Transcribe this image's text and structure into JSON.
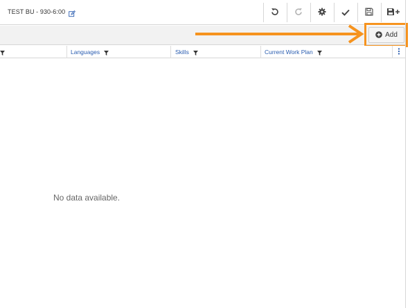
{
  "header": {
    "title": "TEST BU - 930-6:00",
    "edit_icon": "edit-icon"
  },
  "toolbar": {
    "undo_icon": "undo-icon",
    "redo_icon": "redo-icon",
    "settings_icon": "gear-icon",
    "approve_icon": "check-icon",
    "save_icon": "save-icon",
    "save_new_icon": "save-plus-icon"
  },
  "subbar": {
    "add_label": "Add",
    "add_icon": "plus-circle-icon"
  },
  "table": {
    "columns": [
      {
        "label": ""
      },
      {
        "label": "Languages"
      },
      {
        "label": "Skills"
      },
      {
        "label": "Current Work Plan"
      }
    ],
    "menu_icon": "vertical-dots-icon",
    "empty_text": "No data available."
  },
  "annotation": {
    "highlight_color": "#f6931e"
  },
  "colors": {
    "accent_link": "#2a5db0",
    "annotation": "#f6931e"
  }
}
